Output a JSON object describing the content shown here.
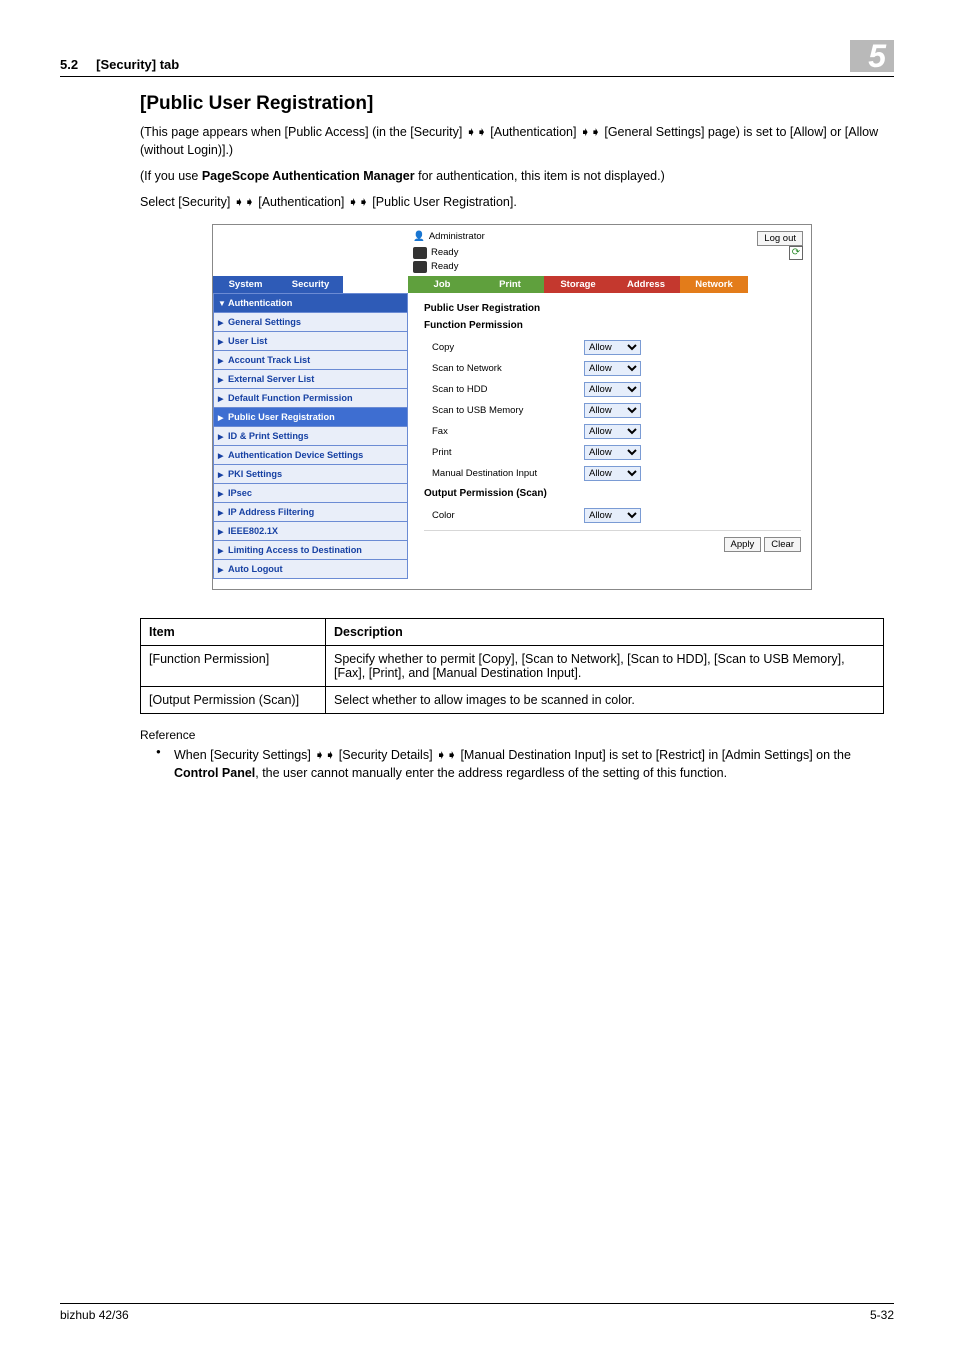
{
  "header": {
    "section": "5.2",
    "section_title": "[Security] tab",
    "chapter_num": "5"
  },
  "title": "[Public User Registration]",
  "para1_pre": "(This page appears when [Public Access] (in the [Security] ",
  "para1_mid1": " [Authentication] ",
  "para1_post": " [General Settings] page) is set to [Allow] or [Allow (without Login)].)",
  "para2_pre": "(If you use ",
  "para2_bold": "PageScope Authentication Manager",
  "para2_post": " for authentication, this item is not displayed.)",
  "para3_pre": "Select [Security] ",
  "para3_mid": " [Authentication] ",
  "para3_post": " [Public User Registration].",
  "shot": {
    "admin_label": "Administrator",
    "logout": "Log out",
    "ready": "Ready",
    "tabs": {
      "system": "System",
      "security": "Security",
      "job": "Job",
      "print": "Print",
      "storage": "Storage",
      "address": "Address",
      "network": "Network"
    },
    "side": {
      "auth": "Authentication",
      "general": "General Settings",
      "userlist": "User List",
      "acct": "Account Track List",
      "extsrv": "External Server List",
      "deffp": "Default Function Permission",
      "pubreg": "Public User Registration",
      "idprint": "ID & Print Settings",
      "authdev": "Authentication Device Settings",
      "pki": "PKI Settings",
      "ipsec": "IPsec",
      "ipfilt": "IP Address Filtering",
      "ieee": "IEEE802.1X",
      "limit": "Limiting Access to Destination",
      "autolog": "Auto Logout"
    },
    "content": {
      "heading": "Public User Registration",
      "sub1": "Function Permission",
      "rows": [
        {
          "label": "Copy",
          "val": "Allow"
        },
        {
          "label": "Scan to Network",
          "val": "Allow"
        },
        {
          "label": "Scan to HDD",
          "val": "Allow"
        },
        {
          "label": "Scan to USB Memory",
          "val": "Allow"
        },
        {
          "label": "Fax",
          "val": "Allow"
        },
        {
          "label": "Print",
          "val": "Allow"
        },
        {
          "label": "Manual Destination Input",
          "val": "Allow"
        }
      ],
      "sub2": "Output Permission (Scan)",
      "rows2": [
        {
          "label": "Color",
          "val": "Allow"
        }
      ],
      "apply": "Apply",
      "clear": "Clear"
    }
  },
  "table": {
    "h1": "Item",
    "h2": "Description",
    "r1c1": "[Function Permission]",
    "r1c2": "Specify whether to permit [Copy], [Scan to Network], [Scan to HDD], [Scan to USB Memory], [Fax], [Print], and [Manual Destination Input].",
    "r2c1": "[Output Permission (Scan)]",
    "r2c2": "Select whether to allow images to be scanned in color."
  },
  "ref_head": "Reference",
  "ref_pre": "When [Security Settings] ",
  "ref_mid1": " [Security Details] ",
  "ref_mid2": " [Manual Destination Input] is set to [Restrict] in [Admin Settings] on the ",
  "ref_bold": "Control Panel",
  "ref_post": ", the user cannot manually enter the address regardless of the setting of this function.",
  "footer": {
    "model": "bizhub 42/36",
    "page": "5-32"
  },
  "arrow": "➧➧"
}
